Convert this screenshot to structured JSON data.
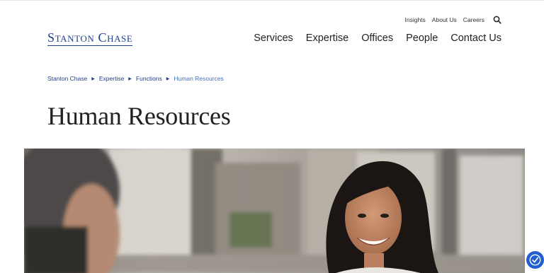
{
  "header": {
    "logo_text": "Stanton Chase",
    "utility_links": [
      "Insights",
      "About Us",
      "Careers"
    ],
    "search_icon": "search-icon",
    "main_nav": [
      "Services",
      "Expertise",
      "Offices",
      "People",
      "Contact Us"
    ]
  },
  "breadcrumb": {
    "items": [
      "Stanton Chase",
      "Expertise",
      "Functions"
    ],
    "current": "Human Resources"
  },
  "page": {
    "title": "Human Resources"
  },
  "hero": {
    "image_icon": "office-meeting-photo"
  },
  "accessibility": {
    "icon": "accessibility-icon"
  },
  "colors": {
    "brand": "#1f3f8a",
    "link": "#1f3f8a",
    "accessibility_button": "#1f5fcf"
  }
}
